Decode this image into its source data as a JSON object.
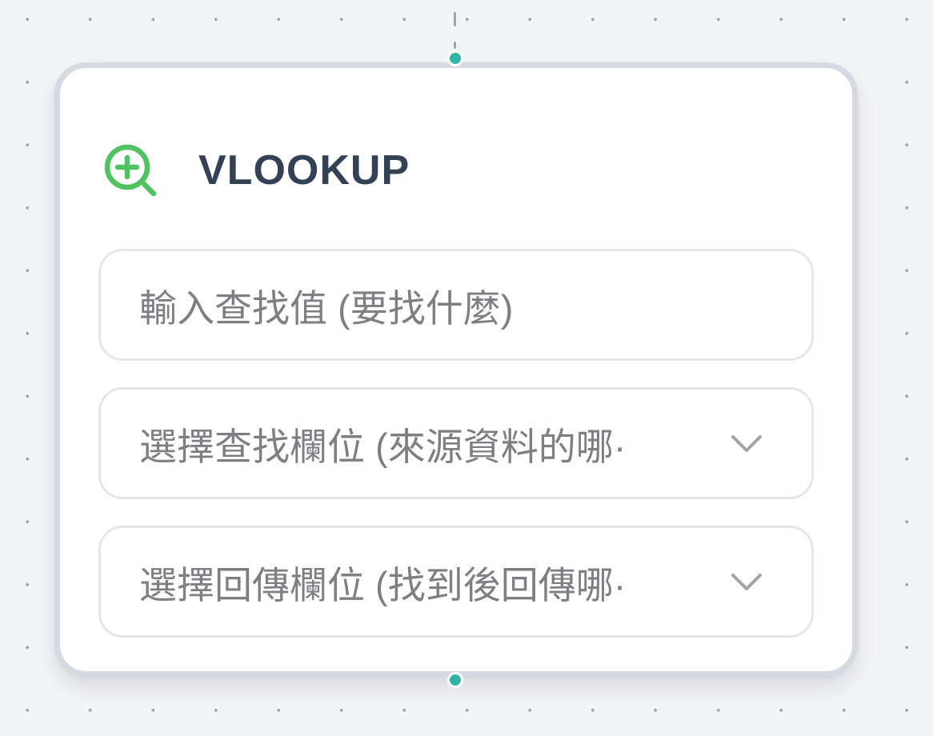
{
  "node": {
    "title": "VLOOKUP",
    "icon": "zoom-in-icon",
    "accent_color": "#4fc35f",
    "title_color": "#334155"
  },
  "fields": {
    "lookup_value": {
      "placeholder": "輸入查找值 (要找什麼)"
    },
    "lookup_column": {
      "value": "選擇查找欄位 (來源資料的哪·",
      "icon": "chevron-down-icon"
    },
    "return_column": {
      "value": "選擇回傳欄位 (找到後回傳哪·",
      "icon": "chevron-down-icon"
    }
  },
  "connection": {
    "handle_color": "#2eb5a5"
  }
}
